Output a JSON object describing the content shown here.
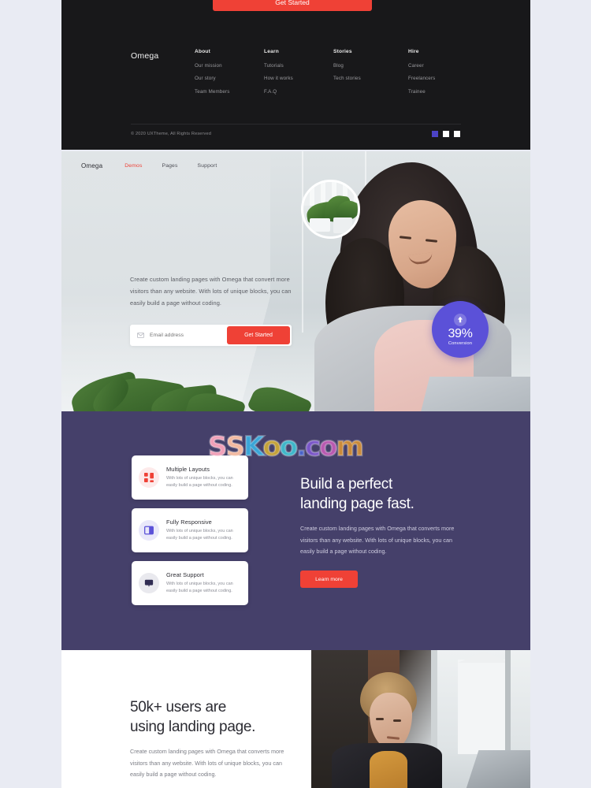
{
  "footer": {
    "cta_label": "Get Started",
    "brand": "Omega",
    "columns": [
      {
        "head": "About",
        "links": [
          "Our mission",
          "Our story",
          "Team Members"
        ]
      },
      {
        "head": "Learn",
        "links": [
          "Tutorials",
          "How  it works",
          "F.A.Q"
        ]
      },
      {
        "head": "Stories",
        "links": [
          "Blog",
          "Tech stories"
        ]
      },
      {
        "head": "Hire",
        "links": [
          "Career",
          "Freelancers",
          "Trainee"
        ]
      }
    ],
    "copyright": "© 2020 UXTheme, All Rights Reserved",
    "dots": [
      "active",
      "inactive",
      "inactive"
    ]
  },
  "nav": {
    "brand": "Omega",
    "links": [
      "Demos",
      "Pages",
      "Support"
    ],
    "active": "Demos"
  },
  "hero": {
    "paragraph": "Create custom landing pages with Omega that convert more visitors than any website. With lots of unique blocks, you can easily build a page without coding.",
    "email_placeholder": "Email address",
    "email_value": "",
    "mail_icon": "envelope-icon",
    "cta_label": "Get Started",
    "badge": {
      "arrow_icon": "arrow-up-icon",
      "value": "39%",
      "label": "Conversion",
      "color": "#5b51d8"
    },
    "inset_image_alt": "potted-plants-circle"
  },
  "features": {
    "background": "#45406a",
    "cards": [
      {
        "icon": "grid-layout-icon",
        "title": "Multiple Layouts",
        "desc": "With lots of unique blocks, you can easily build a page without coding."
      },
      {
        "icon": "responsive-columns-icon",
        "title": "Fully Responsive",
        "desc": "With lots of unique blocks, you can easily build a page without coding."
      },
      {
        "icon": "chat-bubble-icon",
        "title": "Great Support",
        "desc": "With lots of unique blocks, you can easily build a page without coding."
      }
    ],
    "heading_line1": "Build a perfect",
    "heading_line2": "landing page fast.",
    "paragraph": "Create custom landing pages with Omega that converts more visitors than any website. With lots of unique blocks, you can easily build a page without coding.",
    "cta_label": "Learn more"
  },
  "bottom": {
    "heading_line1": "50k+ users are",
    "heading_line2": "using landing page.",
    "paragraph": "Create custom landing pages with Omega that converts more visitors than any website. With lots of unique blocks, you can easily build a page without coding.",
    "photo_alt": "man-working-on-laptop-by-window"
  },
  "watermark": {
    "text": "SSKoo.com",
    "letters": [
      {
        "ch": "S",
        "color": "#f0a0b8"
      },
      {
        "ch": "S",
        "color": "#f2b9a0"
      },
      {
        "ch": "K",
        "color": "#3aa6d8"
      },
      {
        "ch": "o",
        "color": "#c4a23a"
      },
      {
        "ch": "o",
        "color": "#3fb6c9"
      },
      {
        "ch": ".",
        "color": "#4a63c8"
      },
      {
        "ch": "c",
        "color": "#7a56c8"
      },
      {
        "ch": "o",
        "color": "#b85ab0"
      },
      {
        "ch": "m",
        "color": "#c98a3a"
      }
    ]
  },
  "colors": {
    "accent_red": "#ef4136",
    "purple": "#45406a",
    "badge_purple": "#5b51d8",
    "dark_panel": "#18181a",
    "page_bg": "#e9ebf3"
  }
}
